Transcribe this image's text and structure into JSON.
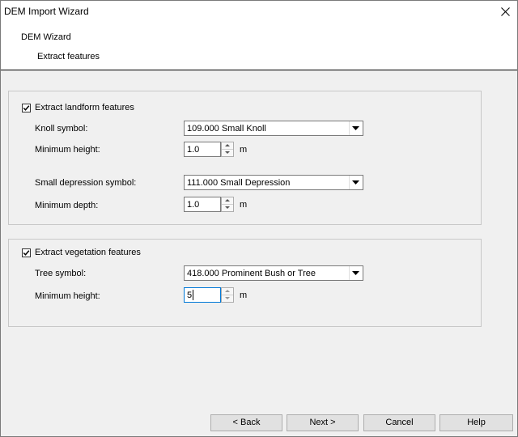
{
  "window": {
    "title": "DEM Import Wizard",
    "close_glyph": "✕"
  },
  "header": {
    "title": "DEM Wizard",
    "subtitle": "Extract features"
  },
  "landform": {
    "checkbox_label": "Extract landform features",
    "checked": true,
    "knoll_label": "Knoll symbol:",
    "knoll_value": "109.000 Small Knoll",
    "min_height_label": "Minimum height:",
    "min_height_value": "1.0",
    "min_height_unit": "m",
    "depression_label": "Small depression symbol:",
    "depression_value": "111.000 Small Depression",
    "min_depth_label": "Minimum depth:",
    "min_depth_value": "1.0",
    "min_depth_unit": "m"
  },
  "vegetation": {
    "checkbox_label": "Extract vegetation features",
    "checked": true,
    "tree_label": "Tree symbol:",
    "tree_value": "418.000 Prominent Bush or Tree",
    "min_height_label": "Minimum height:",
    "min_height_value": "5",
    "min_height_unit": "m"
  },
  "buttons": {
    "back": "< Back",
    "next": "Next >",
    "cancel": "Cancel",
    "help": "Help"
  },
  "icons": {
    "close": "close-icon",
    "checkmark": "checkmark-icon",
    "dropdown": "chevron-down-icon",
    "spin_up": "spin-up-icon",
    "spin_down": "spin-down-icon"
  }
}
